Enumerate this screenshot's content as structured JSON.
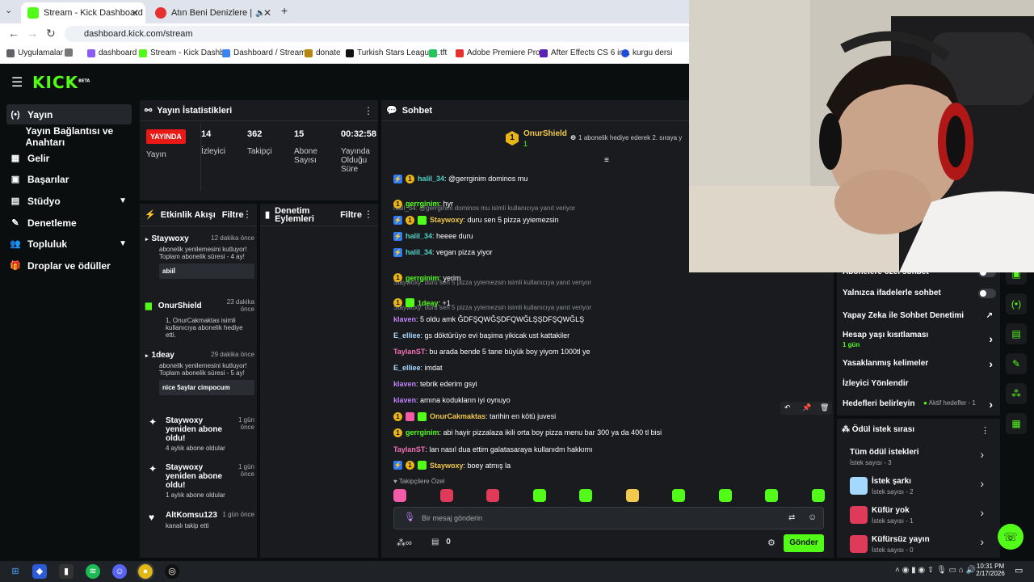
{
  "browser": {
    "tabs": [
      {
        "label": "Stream - Kick Dashboard",
        "active": true
      },
      {
        "label": "Atın Beni Denizlere | YouTube",
        "active": false
      }
    ],
    "url": "dashboard.kick.com/stream",
    "bookmarks": [
      "Uygulamalar",
      "dashboard",
      "Stream - Kick Dashb...",
      "Dashboard / Stream...",
      "donate",
      "Turkish Stars League...",
      "tft",
      "Adobe Premiere Pro...",
      "After Effects CS 6 in...",
      "kurgu dersi"
    ]
  },
  "header": {
    "logo": "KICK",
    "logo_sup": "BETA"
  },
  "sidebar": {
    "items": [
      {
        "label": "Yayın",
        "icon": "broadcast-icon"
      },
      {
        "label": "Yayın Bağlantısı ve Anahtarı",
        "icon": ""
      },
      {
        "label": "Gelir",
        "icon": "revenue-icon"
      },
      {
        "label": "Başarılar",
        "icon": "trophy-icon"
      },
      {
        "label": "Stüdyo",
        "icon": "studio-icon"
      },
      {
        "label": "Denetleme",
        "icon": "wrench-icon"
      },
      {
        "label": "Topluluk",
        "icon": "community-icon"
      },
      {
        "label": "Droplar ve ödüller",
        "icon": "gift-icon"
      }
    ]
  },
  "stats": {
    "title": "Yayın İstatistikleri",
    "live": "YAYINDA",
    "live_label": "Yayın",
    "viewers": "14",
    "viewers_label": "İzleyici",
    "followers": "362",
    "followers_label": "Takipçi",
    "subs": "15",
    "subs_label": "Abone Sayısı",
    "duration": "00:32:58",
    "duration_label": "Yayında Olduğu Süre"
  },
  "activity": {
    "title": "Etkinlik Akışı",
    "filter": "Filtre",
    "events": [
      {
        "name": "Staywoxy",
        "time": "12 dakika önce",
        "text": "abonelik yenilemesini kutluyor! Toplam abonelik süresi - 4 ay!",
        "box": "abiiİ"
      },
      {
        "name": "OnurShield",
        "time": "23 dakika önce",
        "text": "1, OnurCakmaktas isimli kullanıcıya abonelik hediye etti.",
        "box": ""
      },
      {
        "name": "1deay",
        "time": "29 dakika önce",
        "text": "abonelik yenilemesini kutluyor! Toplam abonelik süresi - 5 ay!",
        "box": "nice 5aylar cimpocum"
      },
      {
        "name": "Staywoxy yeniden abone oldu!",
        "time": "1 gün önce",
        "text": "4 aylık abone oldular",
        "box": ""
      },
      {
        "name": "Staywoxy yeniden abone oldu!",
        "time": "1 gün önce",
        "text": "1 aylık abone oldular",
        "box": ""
      },
      {
        "name": "AltKomsu123",
        "time": "1 gün önce",
        "text": "kanalı takip etti",
        "box": ""
      }
    ]
  },
  "moderation": {
    "title": "Denetim Eylemleri",
    "filter": "Filtre"
  },
  "chat": {
    "title": "Sohbet",
    "pinned_user": "OnurShield",
    "pinned_count": "1",
    "pinned_text": "1 abonelik hediye ederek 2. sıraya y",
    "messages": [
      {
        "type": "msg",
        "user": "halil_34",
        "color": "#4fd1c5",
        "badges": [
          "og",
          "sub"
        ],
        "text": "@gerrginim dominos mu"
      },
      {
        "type": "reply",
        "text": "halil_34: @gerrginim dominos mu isimli kullanıcıya yanıt veriyor"
      },
      {
        "type": "msg",
        "user": "gerrginim",
        "color": "#53fc18",
        "badges": [
          "sub"
        ],
        "text": "hyr"
      },
      {
        "type": "msg",
        "user": "Staywoxy",
        "color": "#f2c94c",
        "badges": [
          "og",
          "sub",
          "grn"
        ],
        "text": "duru sen 5 pizza yyiemezsin"
      },
      {
        "type": "msg",
        "user": "halil_34",
        "color": "#4fd1c5",
        "badges": [
          "og"
        ],
        "text": "heeee duru"
      },
      {
        "type": "msg",
        "user": "halil_34",
        "color": "#4fd1c5",
        "badges": [
          "og"
        ],
        "text": "vegan pizza yiyor"
      },
      {
        "type": "reply",
        "text": "Staywoxy: duru sen 5 pizza yyiemezsin isimli kullanıcıya yanıt veriyor"
      },
      {
        "type": "msg",
        "user": "gerrginim",
        "color": "#53fc18",
        "badges": [
          "sub"
        ],
        "text": "yerim"
      },
      {
        "type": "reply",
        "text": "Staywoxy: duru sen 5 pizza yyiemezsin isimli kullanıcıya yanıt veriyor"
      },
      {
        "type": "msg",
        "user": "1deay",
        "color": "#53fc18",
        "badges": [
          "sub",
          "grn"
        ],
        "text": "+1"
      },
      {
        "type": "msg",
        "user": "klaven",
        "color": "#c084fc",
        "badges": [],
        "text": "5 oldu amk ĞDFŞQWĞŞDFQWĞLŞŞDFŞQWĞLŞ"
      },
      {
        "type": "msg",
        "user": "E_elliee",
        "color": "#a5d8ff",
        "badges": [],
        "text": "gs döktürüyo evi başima yikicak ust kattakiler"
      },
      {
        "type": "msg",
        "user": "TaylanST",
        "color": "#f472b6",
        "badges": [],
        "text": "bu arada bende 5 tane büyük boy yiyom 1000tl ye"
      },
      {
        "type": "msg",
        "user": "E_elliee",
        "color": "#a5d8ff",
        "badges": [],
        "text": "imdat"
      },
      {
        "type": "msg",
        "user": "klaven",
        "color": "#c084fc",
        "badges": [],
        "text": "tebrik ederim gsyi"
      },
      {
        "type": "msg",
        "user": "klaven",
        "color": "#c084fc",
        "badges": [],
        "text": "amına kodukların iyi oynuyo"
      },
      {
        "type": "msg",
        "user": "OnurCakmaktas",
        "color": "#f2c94c",
        "badges": [
          "sub",
          "pk",
          "grn"
        ],
        "text": "tarihin en kötü juvesi"
      },
      {
        "type": "msg",
        "user": "gerrginim",
        "color": "#53fc18",
        "badges": [
          "sub"
        ],
        "text": "abi hayir pizzalaza ikili orta boy pizza menu bar 300 ya da 400 tl bisi"
      },
      {
        "type": "msg",
        "user": "TaylanST",
        "color": "#f472b6",
        "badges": [],
        "text": "lan nasıl dua ettim galatasaraya kullanıdm hakkımı"
      },
      {
        "type": "msg",
        "user": "Staywoxy",
        "color": "#f2c94c",
        "badges": [
          "og",
          "sub",
          "grn"
        ],
        "text": "boey atmış la"
      }
    ],
    "emote_label": "Takipçilere Özel",
    "input_placeholder": "Bir mesaj gönderin",
    "points": "0",
    "send": "Gönder"
  },
  "chat_settings": {
    "items": [
      {
        "label": "Abonelere özel sohbet",
        "kind": "toggle"
      },
      {
        "label": "Yalnızca ifadelerle sohbet",
        "kind": "toggle"
      },
      {
        "label": "Yapay Zeka ile Sohbet Denetimi",
        "kind": "external"
      },
      {
        "label": "Hesap yaşı kısıtlaması",
        "kind": "arrow",
        "sub": "1 gün"
      },
      {
        "label": "Yasaklanmış kelimeler",
        "kind": "arrow"
      },
      {
        "label": "İzleyici Yönlendir",
        "kind": "none"
      },
      {
        "label": "Hedefleri belirleyin",
        "kind": "arrow",
        "extra": "Aktif hedefler - 1"
      }
    ]
  },
  "rewards": {
    "title": "Ödül istek sırası",
    "all": "Tüm ödül istekleri",
    "all_count": "İstek sayısı - 3",
    "items": [
      {
        "title": "İstek şarkı",
        "count": "İstek sayısı - 2",
        "color": "#a5d8ff"
      },
      {
        "title": "Küfür yok",
        "count": "İstek sayısı - 1",
        "color": "#e03a5b"
      },
      {
        "title": "Küfürsüz yayın",
        "count": "İstek sayısı - 0",
        "color": "#e03a5b"
      }
    ]
  },
  "taskbar": {
    "time": "10:31 PM",
    "date": "2/17/2026"
  }
}
